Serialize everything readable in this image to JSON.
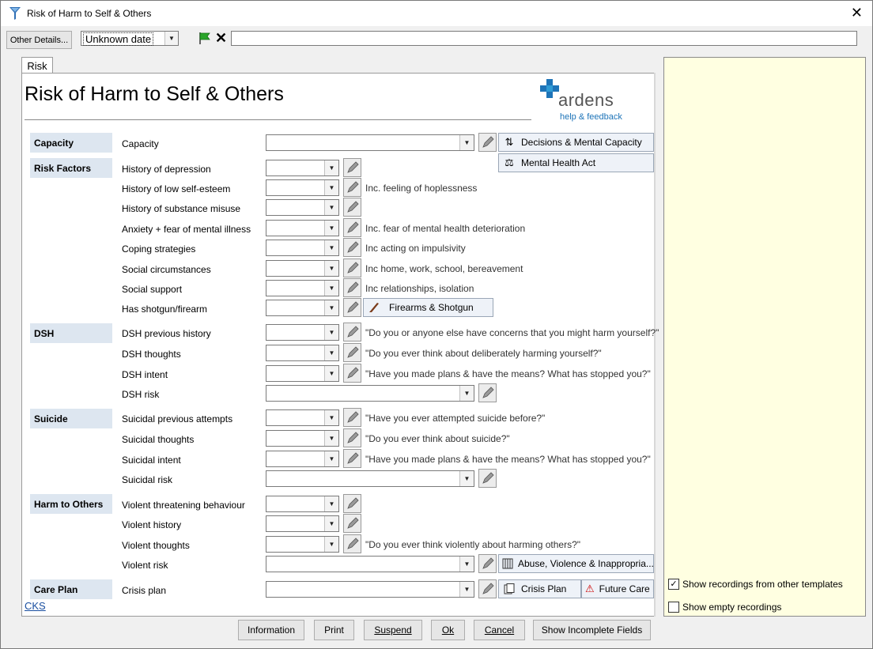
{
  "window": {
    "title": "Risk of Harm to Self & Others",
    "close_glyph": "✕"
  },
  "toolbar": {
    "other_details": "Other Details...",
    "date_value": "Unknown date",
    "clear_glyph": "✕",
    "note_value": ""
  },
  "tabs": [
    {
      "label": "Risk"
    }
  ],
  "form": {
    "title": "Risk of Harm to Self & Others"
  },
  "logo": {
    "word": "ardens",
    "sub": "help & feedback",
    "colors": {
      "cross": "#1e74b8",
      "accent": "#2e9bd6"
    }
  },
  "sections": {
    "capacity": "Capacity",
    "risk_factors": "Risk Factors",
    "dsh": "DSH",
    "suicide": "Suicide",
    "harm_to_others": "Harm to Others",
    "care_plan": "Care Plan"
  },
  "rows": {
    "capacity": {
      "label": "Capacity"
    },
    "depression": {
      "label": "History of depression"
    },
    "self_esteem": {
      "label": "History of low self-esteem",
      "hint": "Inc. feeling of hoplessness"
    },
    "substance": {
      "label": "History of substance misuse"
    },
    "anxiety": {
      "label": "Anxiety + fear of mental illness",
      "hint": "Inc. fear of mental health deterioration"
    },
    "coping": {
      "label": "Coping strategies",
      "hint": "Inc acting on impulsivity"
    },
    "social_circ": {
      "label": "Social circumstances",
      "hint": "Inc home, work, school, bereavement"
    },
    "social_support": {
      "label": "Social support",
      "hint": "Inc relationships, isolation"
    },
    "firearm": {
      "label": "Has shotgun/firearm"
    },
    "dsh_history": {
      "label": "DSH previous history",
      "hint": "\"Do you or anyone else have concerns that you might harm yourself?\""
    },
    "dsh_thoughts": {
      "label": "DSH thoughts",
      "hint": "\"Do you ever think about deliberately harming yourself?\""
    },
    "dsh_intent": {
      "label": "DSH intent",
      "hint": "\"Have you made plans & have the means? What has stopped you?\""
    },
    "dsh_risk": {
      "label": "DSH risk"
    },
    "sui_attempts": {
      "label": "Suicidal previous attempts",
      "hint": "\"Have you ever attempted suicide before?\""
    },
    "sui_thoughts": {
      "label": "Suicidal thoughts",
      "hint": "\"Do you ever think about suicide?\""
    },
    "sui_intent": {
      "label": "Suicidal intent",
      "hint": "\"Have you made plans & have the means? What has stopped you?\""
    },
    "sui_risk": {
      "label": "Suicidal risk"
    },
    "violent_threat": {
      "label": "Violent threatening behaviour"
    },
    "violent_history": {
      "label": "Violent history"
    },
    "violent_thoughts": {
      "label": "Violent thoughts",
      "hint": "\"Do you ever think violently about harming others?\""
    },
    "violent_risk": {
      "label": "Violent risk"
    },
    "crisis_plan": {
      "label": "Crisis plan"
    }
  },
  "ref_buttons": {
    "decisions": "Decisions & Mental Capacity",
    "mha": "Mental Health Act",
    "firearms": "Firearms & Shotgun",
    "abuse": "Abuse, Violence & Inappropria...",
    "crisis": "Crisis Plan",
    "future": "Future Care P"
  },
  "cks_link": "CKS",
  "side_panel": {
    "show_other": {
      "label": "Show recordings from other templates",
      "checked": true,
      "check_glyph": "✓"
    },
    "show_empty": {
      "label": "Show empty recordings",
      "checked": false
    }
  },
  "buttons": {
    "information": "Information",
    "print": "Print",
    "suspend": "Suspend",
    "ok": "Ok",
    "cancel": "Cancel",
    "show_incomplete": "Show Incomplete Fields"
  },
  "icons": {
    "app": "funnel-logo-icon",
    "flag": "green-flag-icon",
    "pencil": "pencil-icon",
    "dropdown": "chevron-down-icon"
  }
}
